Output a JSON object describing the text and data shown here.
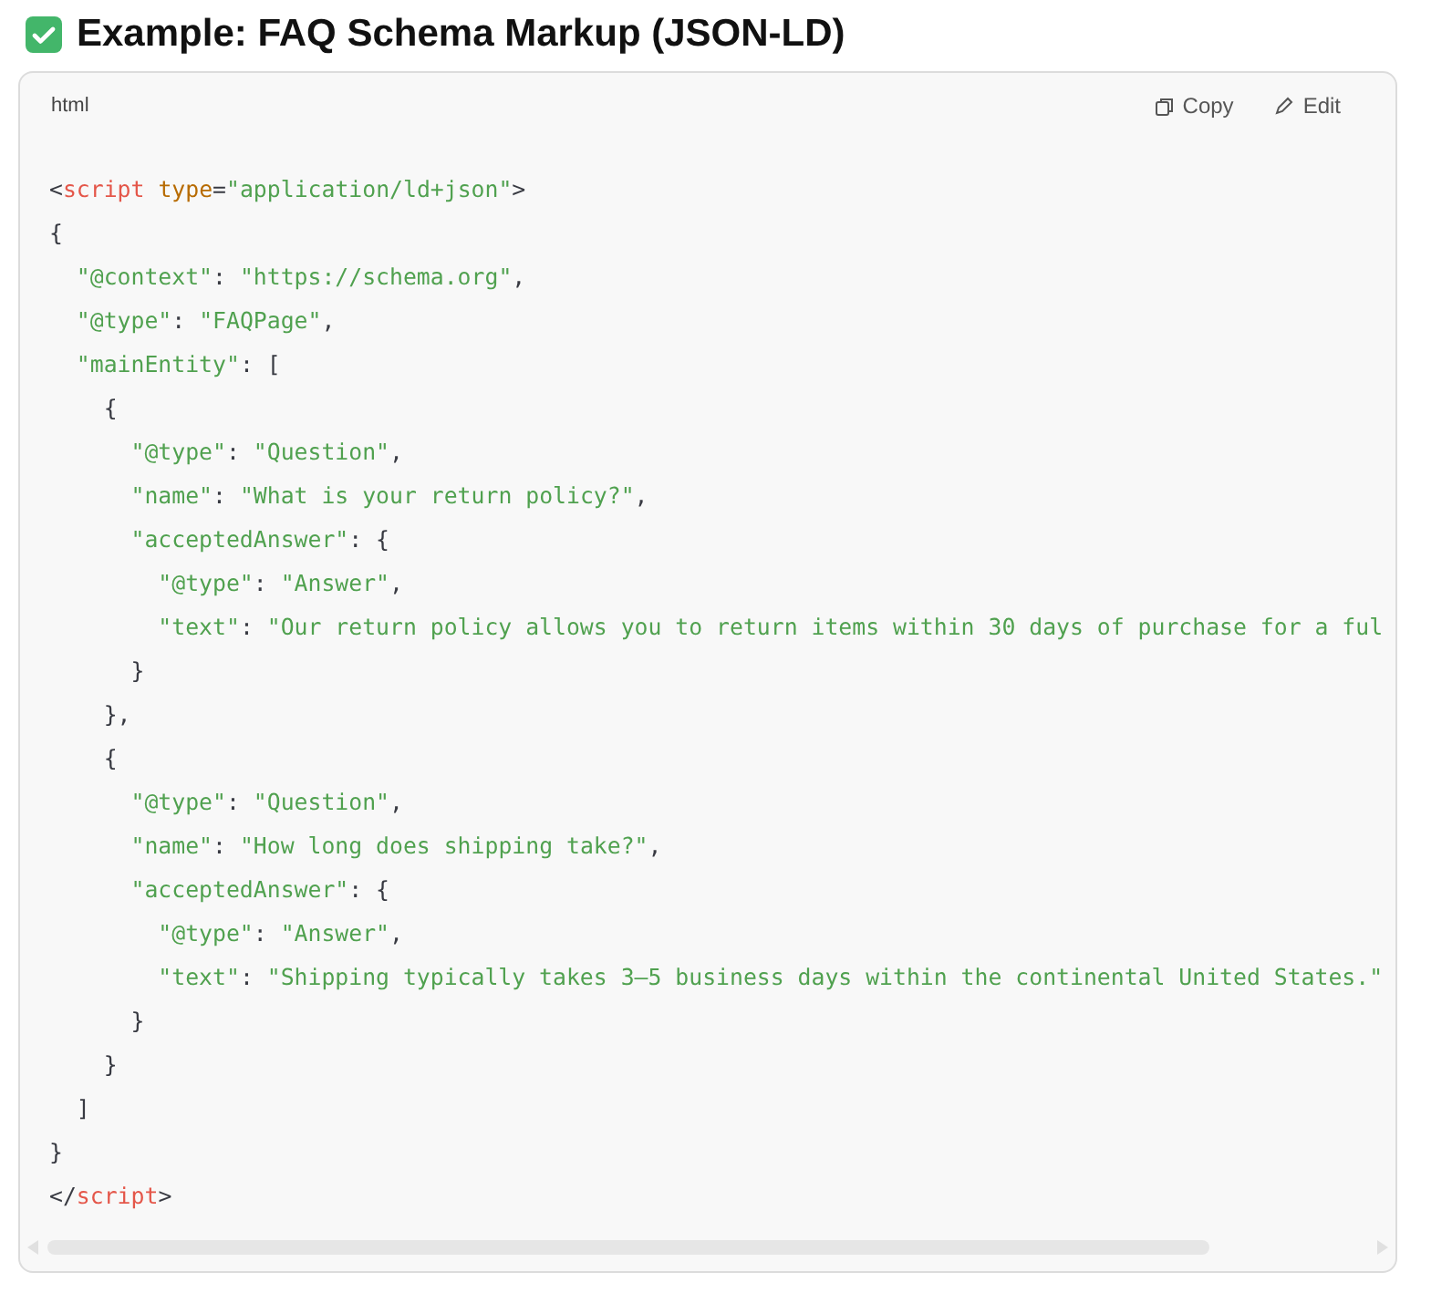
{
  "heading": "Example: FAQ Schema Markup (JSON-LD)",
  "code_block": {
    "language": "html",
    "actions": [
      {
        "kind": "copy",
        "label": "Copy"
      },
      {
        "kind": "edit",
        "label": "Edit"
      }
    ],
    "lines": [
      [
        {
          "kind": "punct",
          "text": "<"
        },
        {
          "kind": "tag",
          "text": "script"
        },
        {
          "kind": "attr",
          "text": " type"
        },
        {
          "kind": "punct",
          "text": "="
        },
        {
          "kind": "string",
          "text": "\"application/ld+json\""
        },
        {
          "kind": "punct",
          "text": ">"
        }
      ],
      [
        {
          "kind": "punct",
          "text": "{"
        }
      ],
      [
        {
          "kind": "string",
          "text": "  \"@context\""
        },
        {
          "kind": "punct",
          "text": ": "
        },
        {
          "kind": "string",
          "text": "\"https://schema.org\""
        },
        {
          "kind": "punct",
          "text": ","
        }
      ],
      [
        {
          "kind": "string",
          "text": "  \"@type\""
        },
        {
          "kind": "punct",
          "text": ": "
        },
        {
          "kind": "string",
          "text": "\"FAQPage\""
        },
        {
          "kind": "punct",
          "text": ","
        }
      ],
      [
        {
          "kind": "string",
          "text": "  \"mainEntity\""
        },
        {
          "kind": "punct",
          "text": ": ["
        }
      ],
      [
        {
          "kind": "punct",
          "text": "    {"
        }
      ],
      [
        {
          "kind": "string",
          "text": "      \"@type\""
        },
        {
          "kind": "punct",
          "text": ": "
        },
        {
          "kind": "string",
          "text": "\"Question\""
        },
        {
          "kind": "punct",
          "text": ","
        }
      ],
      [
        {
          "kind": "string",
          "text": "      \"name\""
        },
        {
          "kind": "punct",
          "text": ": "
        },
        {
          "kind": "string",
          "text": "\"What is your return policy?\""
        },
        {
          "kind": "punct",
          "text": ","
        }
      ],
      [
        {
          "kind": "string",
          "text": "      \"acceptedAnswer\""
        },
        {
          "kind": "punct",
          "text": ": {"
        }
      ],
      [
        {
          "kind": "string",
          "text": "        \"@type\""
        },
        {
          "kind": "punct",
          "text": ": "
        },
        {
          "kind": "string",
          "text": "\"Answer\""
        },
        {
          "kind": "punct",
          "text": ","
        }
      ],
      [
        {
          "kind": "string",
          "text": "        \"text\""
        },
        {
          "kind": "punct",
          "text": ": "
        },
        {
          "kind": "string",
          "text": "\"Our return policy allows you to return items within 30 days of purchase for a ful"
        }
      ],
      [
        {
          "kind": "punct",
          "text": "      }"
        }
      ],
      [
        {
          "kind": "punct",
          "text": "    },"
        }
      ],
      [
        {
          "kind": "punct",
          "text": "    {"
        }
      ],
      [
        {
          "kind": "string",
          "text": "      \"@type\""
        },
        {
          "kind": "punct",
          "text": ": "
        },
        {
          "kind": "string",
          "text": "\"Question\""
        },
        {
          "kind": "punct",
          "text": ","
        }
      ],
      [
        {
          "kind": "string",
          "text": "      \"name\""
        },
        {
          "kind": "punct",
          "text": ": "
        },
        {
          "kind": "string",
          "text": "\"How long does shipping take?\""
        },
        {
          "kind": "punct",
          "text": ","
        }
      ],
      [
        {
          "kind": "string",
          "text": "      \"acceptedAnswer\""
        },
        {
          "kind": "punct",
          "text": ": {"
        }
      ],
      [
        {
          "kind": "string",
          "text": "        \"@type\""
        },
        {
          "kind": "punct",
          "text": ": "
        },
        {
          "kind": "string",
          "text": "\"Answer\""
        },
        {
          "kind": "punct",
          "text": ","
        }
      ],
      [
        {
          "kind": "string",
          "text": "        \"text\""
        },
        {
          "kind": "punct",
          "text": ": "
        },
        {
          "kind": "string",
          "text": "\"Shipping typically takes 3–5 business days within the continental United States.\""
        }
      ],
      [
        {
          "kind": "punct",
          "text": "      }"
        }
      ],
      [
        {
          "kind": "punct",
          "text": "    }"
        }
      ],
      [
        {
          "kind": "punct",
          "text": "  ]"
        }
      ],
      [
        {
          "kind": "punct",
          "text": "}"
        }
      ],
      [
        {
          "kind": "punct",
          "text": "</"
        },
        {
          "kind": "tag",
          "text": "script"
        },
        {
          "kind": "punct",
          "text": ">"
        }
      ]
    ]
  }
}
